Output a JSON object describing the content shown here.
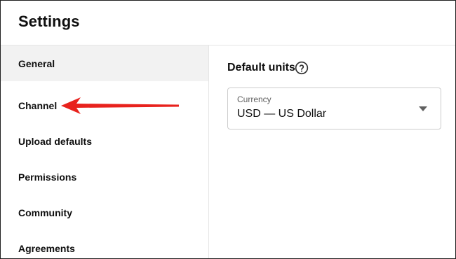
{
  "header": {
    "title": "Settings"
  },
  "sidebar": {
    "items": [
      {
        "label": "General",
        "active": true
      },
      {
        "label": "Channel",
        "active": false
      },
      {
        "label": "Upload defaults",
        "active": false
      },
      {
        "label": "Permissions",
        "active": false
      },
      {
        "label": "Community",
        "active": false
      },
      {
        "label": "Agreements",
        "active": false
      }
    ]
  },
  "main": {
    "section_title": "Default units",
    "help_icon": "help-circle-icon",
    "currency_select": {
      "label": "Currency",
      "value": "USD — US Dollar",
      "icon": "dropdown-arrow-icon"
    }
  },
  "annotation": {
    "arrow_color": "#e8221d",
    "points_to": "Channel"
  },
  "colors": {
    "active_item_bg": "#f2f2f2",
    "divider": "#e5e5e5",
    "text": "#0f0f0f",
    "secondary_text": "#606060"
  }
}
